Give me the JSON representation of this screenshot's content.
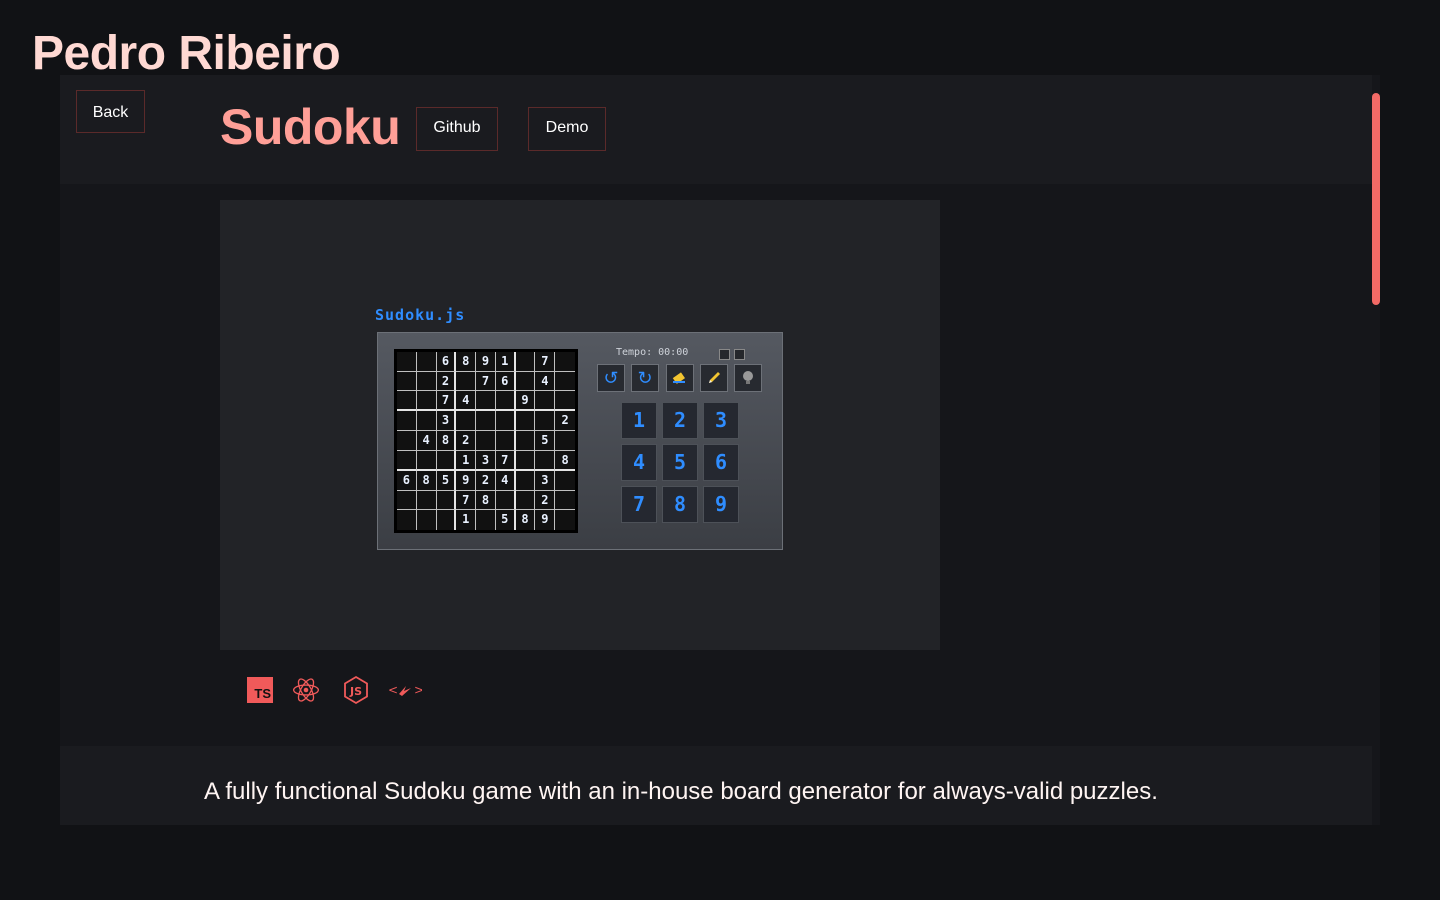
{
  "site": {
    "owner": "Pedro Ribeiro"
  },
  "nav": {
    "back_label": "Back"
  },
  "project": {
    "title": "Sudoku",
    "github_label": "Github",
    "demo_label": "Demo",
    "description": "A fully functional Sudoku game with an in-house board generator for always-valid puzzles."
  },
  "screenshot": {
    "app_title": "Sudoku.js",
    "timer": "Tempo: 00:00",
    "board": [
      [
        "",
        "",
        "6",
        "8",
        "9",
        "1",
        "",
        "7",
        ""
      ],
      [
        "",
        "",
        "2",
        "",
        "7",
        "6",
        "",
        "4",
        ""
      ],
      [
        "",
        "",
        "7",
        "4",
        "",
        "",
        "9",
        "",
        ""
      ],
      [
        "",
        "",
        "3",
        "",
        "",
        "",
        "",
        "",
        "2"
      ],
      [
        "",
        "4",
        "8",
        "2",
        "",
        "",
        "",
        "5",
        ""
      ],
      [
        "",
        "",
        "",
        "1",
        "3",
        "7",
        "",
        "",
        "8"
      ],
      [
        "6",
        "8",
        "5",
        "9",
        "2",
        "4",
        "",
        "3",
        ""
      ],
      [
        "",
        "",
        "",
        "7",
        "8",
        "",
        "",
        "2",
        ""
      ],
      [
        "",
        "",
        "",
        "1",
        "",
        "5",
        "8",
        "9",
        ""
      ]
    ],
    "tools": [
      "undo-icon",
      "redo-icon",
      "eraser-icon",
      "pencil-icon",
      "hint-icon"
    ],
    "numpad": [
      "1",
      "2",
      "3",
      "4",
      "5",
      "6",
      "7",
      "8",
      "9"
    ]
  },
  "tech_stack": [
    "typescript-icon",
    "react-icon",
    "nodejs-icon",
    "vite-icon"
  ],
  "colors": {
    "accent": "#f05a5a",
    "title": "#ff9f97",
    "background": "#111215",
    "numpad_text": "#2f8dff"
  }
}
